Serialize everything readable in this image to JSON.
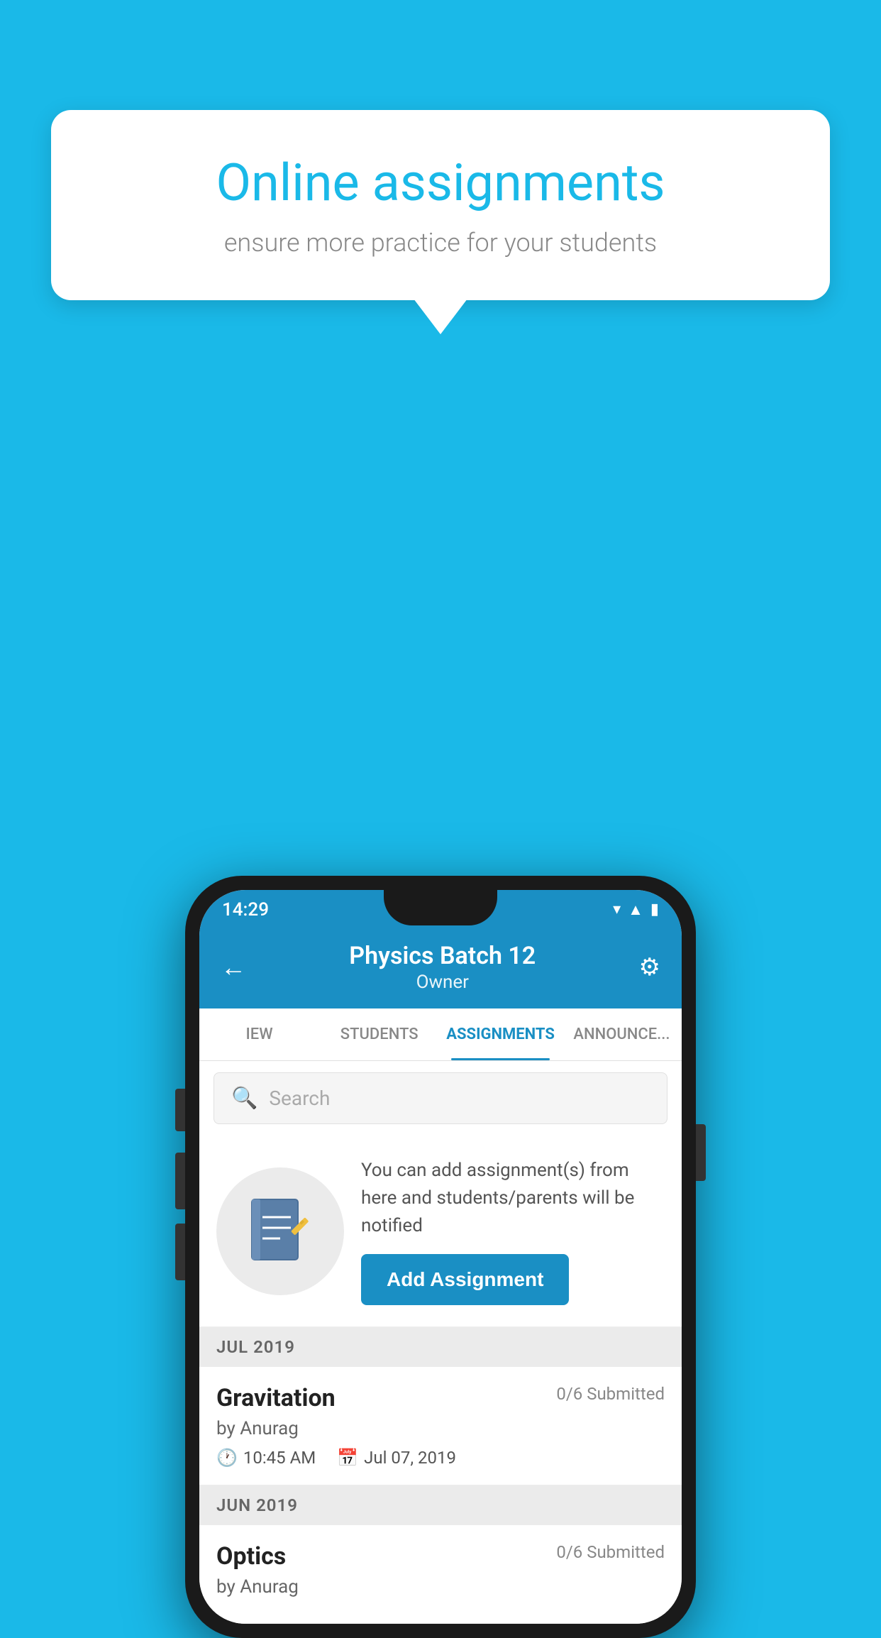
{
  "background_color": "#1ab9e8",
  "speech_bubble": {
    "title": "Online assignments",
    "subtitle": "ensure more practice for your students"
  },
  "phone": {
    "status_bar": {
      "time": "14:29",
      "icons": [
        "wifi",
        "signal",
        "battery"
      ]
    },
    "header": {
      "title": "Physics Batch 12",
      "subtitle": "Owner",
      "back_label": "←",
      "settings_label": "⚙"
    },
    "tabs": [
      {
        "label": "IEW",
        "active": false
      },
      {
        "label": "STUDENTS",
        "active": false
      },
      {
        "label": "ASSIGNMENTS",
        "active": true
      },
      {
        "label": "ANNOUNCEMENTS",
        "active": false
      }
    ],
    "search": {
      "placeholder": "Search"
    },
    "promo": {
      "text": "You can add assignment(s) from here and students/parents will be notified",
      "button_label": "Add Assignment"
    },
    "sections": [
      {
        "label": "JUL 2019",
        "assignments": [
          {
            "title": "Gravitation",
            "status": "0/6 Submitted",
            "author": "by Anurag",
            "time": "10:45 AM",
            "date": "Jul 07, 2019"
          }
        ]
      },
      {
        "label": "JUN 2019",
        "assignments": [
          {
            "title": "Optics",
            "status": "0/6 Submitted",
            "author": "by Anurag",
            "time": "",
            "date": ""
          }
        ]
      }
    ]
  }
}
